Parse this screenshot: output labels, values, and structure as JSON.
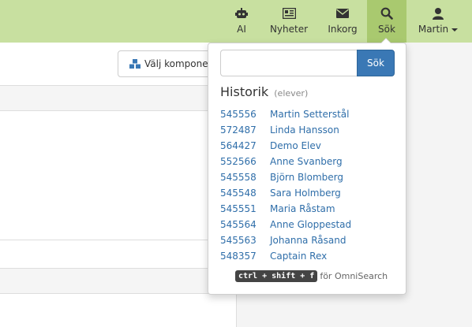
{
  "nav": {
    "items": [
      {
        "label": "AI",
        "icon": "robot-icon"
      },
      {
        "label": "Nyheter",
        "icon": "newspaper-icon"
      },
      {
        "label": "Inkorg",
        "icon": "envelope-icon"
      },
      {
        "label": "Sök",
        "icon": "search-icon"
      },
      {
        "label": "Martin",
        "icon": "user-icon"
      }
    ],
    "active_color": "#a9c96f",
    "bar_color": "#c8e0a0"
  },
  "main": {
    "component_button_label": "Välj komponenter"
  },
  "search": {
    "input_value": "",
    "button_label": "Sök",
    "history_title": "Historik",
    "history_subtitle": "(elever)",
    "history": [
      {
        "id": "545556",
        "name": "Martin Setterstål"
      },
      {
        "id": "572487",
        "name": "Linda Hansson"
      },
      {
        "id": "564427",
        "name": "Demo Elev"
      },
      {
        "id": "552566",
        "name": "Anne Svanberg"
      },
      {
        "id": "545558",
        "name": "Björn Blomberg"
      },
      {
        "id": "545548",
        "name": "Sara Holmberg"
      },
      {
        "id": "545551",
        "name": "Maria Råstam"
      },
      {
        "id": "545564",
        "name": "Anne Gloppestad"
      },
      {
        "id": "545563",
        "name": "Johanna Råsand"
      },
      {
        "id": "548357",
        "name": "Captain Rex"
      }
    ],
    "shortcut_keys": "ctrl + shift + f",
    "shortcut_text": "för OmniSearch",
    "button_color": "#3a78b5",
    "link_color": "#2f6ea9"
  }
}
